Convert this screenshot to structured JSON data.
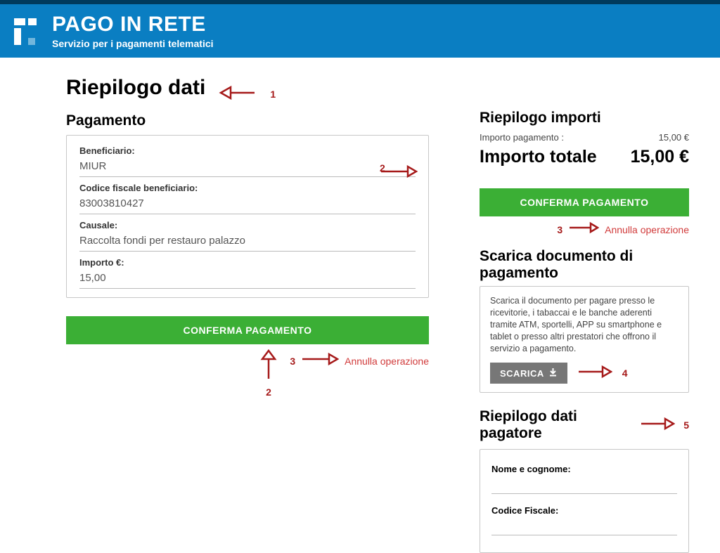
{
  "header": {
    "title": "PAGO IN RETE",
    "subtitle": "Servizio per i pagamenti telematici"
  },
  "page": {
    "title": "Riepilogo dati"
  },
  "payment": {
    "section_label": "Pagamento",
    "beneficiary_label": "Beneficiario:",
    "beneficiary_value": "MIUR",
    "tax_code_label": "Codice fiscale beneficiario:",
    "tax_code_value": "83003810427",
    "reason_label": "Causale:",
    "reason_value": "Raccolta fondi per restauro palazzo",
    "amount_label": "Importo €:",
    "amount_value": "15,00",
    "confirm_label": "CONFERMA PAGAMENTO",
    "cancel_label": "Annulla operazione"
  },
  "summary": {
    "section_label": "Riepilogo importi",
    "row_label": "Importo pagamento :",
    "row_value": "15,00 €",
    "total_label": "Importo totale",
    "total_value": "15,00 €",
    "confirm_label": "CONFERMA PAGAMENTO",
    "cancel_label": "Annulla operazione"
  },
  "download": {
    "section_label": "Scarica documento di pagamento",
    "description": "Scarica il documento per pagare presso le ricevitorie, i tabaccai e le banche aderenti tramite ATM, sportelli, APP su smartphone e tablet o presso altri prestatori che offrono il servizio a pagamento.",
    "button_label": "SCARICA"
  },
  "payer": {
    "section_label": "Riepilogo dati pagatore",
    "name_label": "Nome e cognome:",
    "tax_code_label": "Codice Fiscale:"
  },
  "callouts": {
    "c1": "1",
    "c2": "2",
    "c3": "3",
    "c4": "4",
    "c5": "5"
  }
}
